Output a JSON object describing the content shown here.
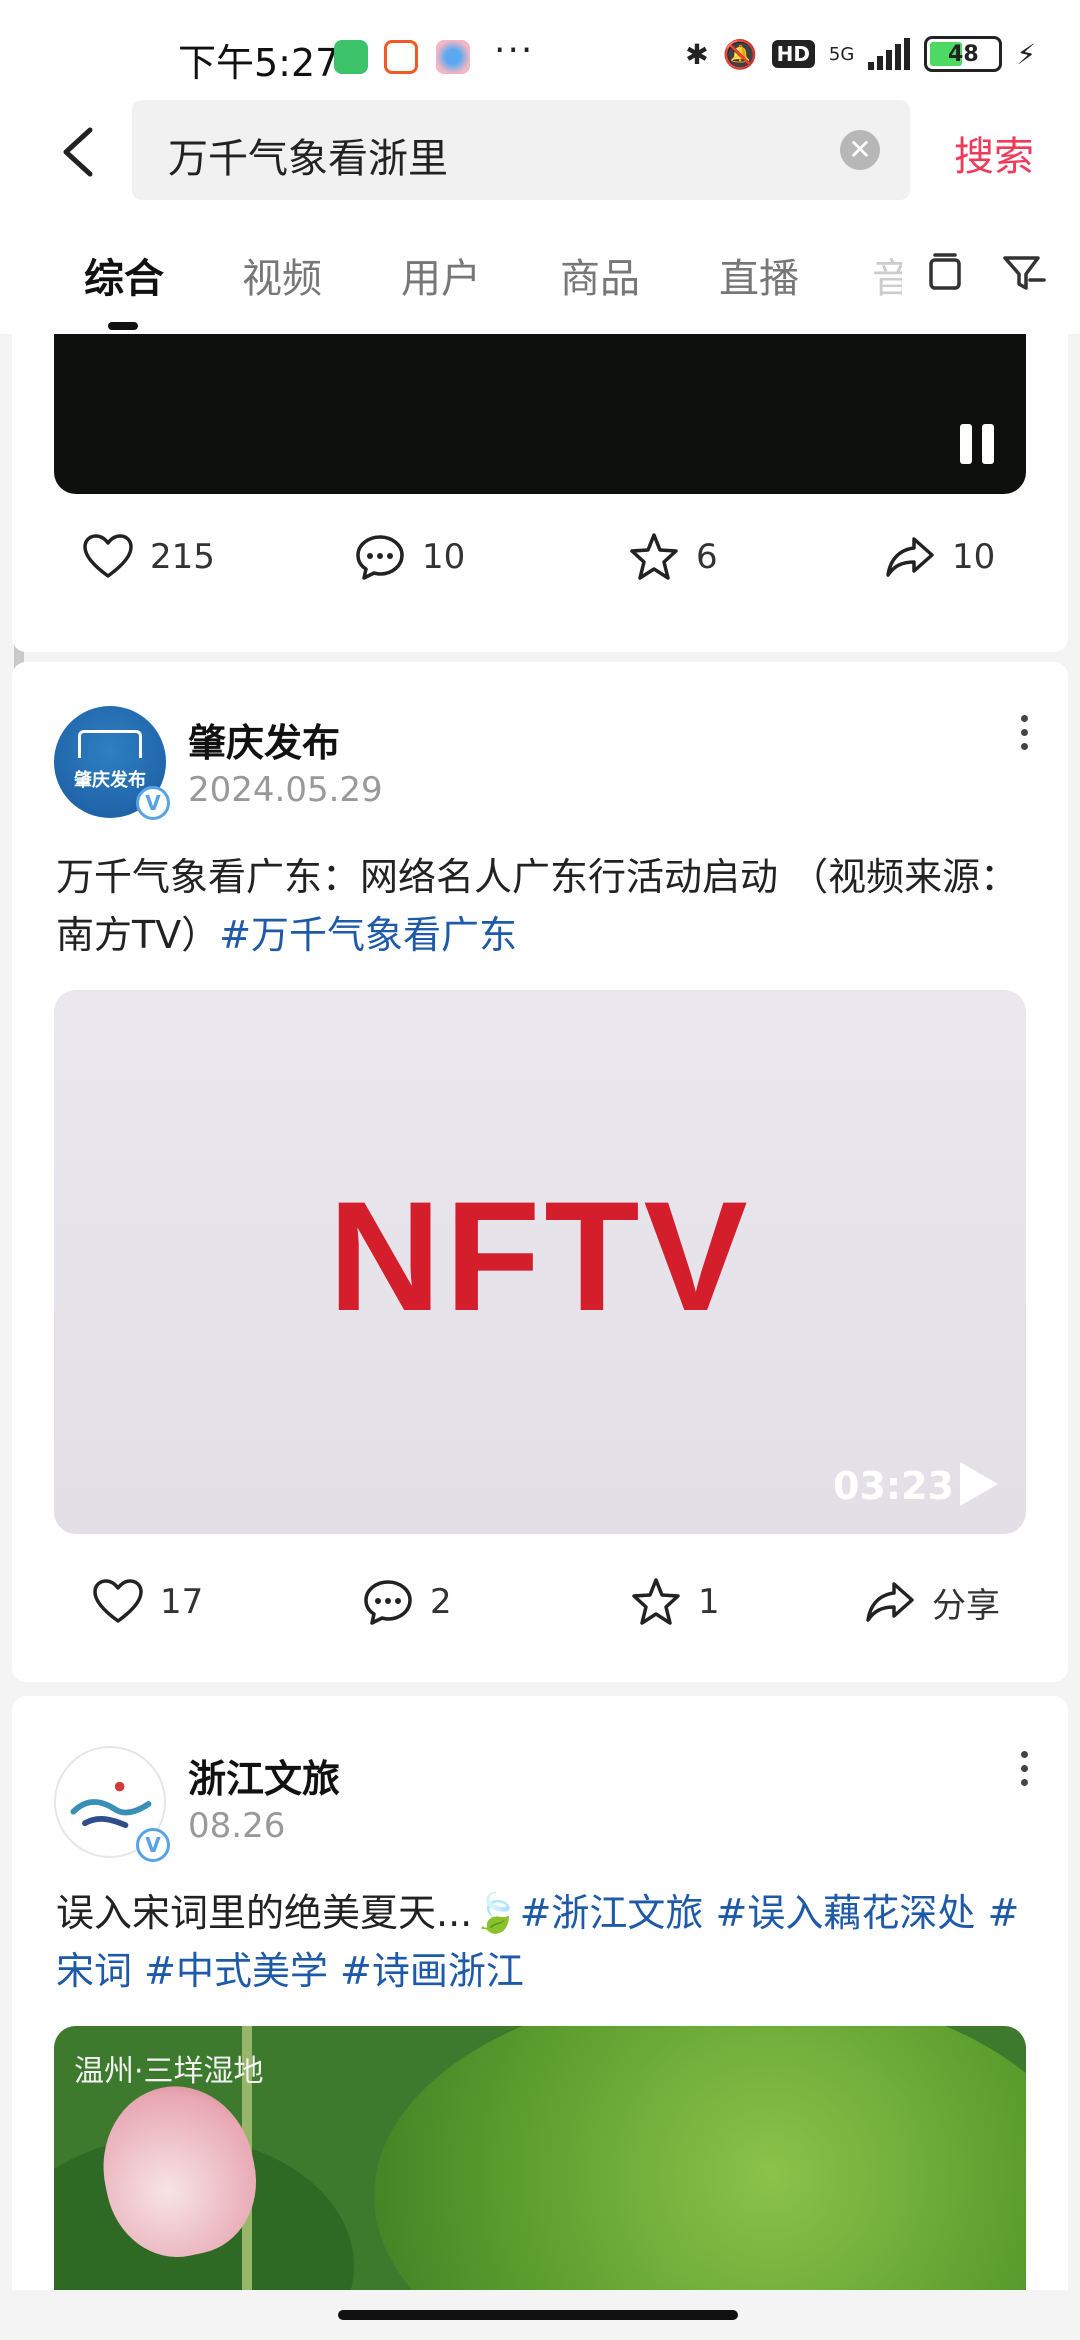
{
  "status_bar": {
    "time": "下午5:27",
    "network": "5G",
    "hd": "HD",
    "battery": "48",
    "battery_level": 0.48,
    "colors": {
      "app1": "#3cc36a",
      "app2": "#f15a24",
      "app3": "#5aa9f0"
    }
  },
  "search": {
    "query": "万千气象看浙里",
    "button": "搜索"
  },
  "tabs": [
    {
      "label": "综合",
      "active": true
    },
    {
      "label": "视频",
      "active": false
    },
    {
      "label": "用户",
      "active": false
    },
    {
      "label": "商品",
      "active": false
    },
    {
      "label": "直播",
      "active": false
    },
    {
      "label": "音",
      "active": false
    }
  ],
  "card1": {
    "likes": "215",
    "comments": "10",
    "favorites": "6",
    "shares": "10"
  },
  "card2": {
    "author": "肇庆发布",
    "avatar_text": "肇庆发布",
    "date": "2024.05.29",
    "text": "万千气象看广东：网络名人广东行活动启动 （视频来源：南方TV）",
    "hashtags": [
      "#万千气象看广东"
    ],
    "video_logo": "NFTV",
    "duration": "03:23",
    "likes": "17",
    "comments": "2",
    "favorites": "1",
    "share_label": "分享"
  },
  "card3": {
    "author": "浙江文旅",
    "date": "08.26",
    "text": "误入宋词里的绝美夏天...🍃",
    "hashtags": [
      "#浙江文旅",
      "#误入藕花深处",
      "#宋词",
      "#中式美学",
      "#诗画浙江"
    ],
    "image_caption": "温州·三垟湿地"
  },
  "verified_badge": "V",
  "accent_color": "#f03a5a",
  "tag_color": "#1e5aa8"
}
